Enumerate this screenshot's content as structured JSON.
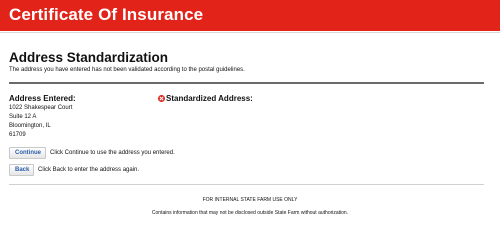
{
  "header": {
    "title": "Certificate Of Insurance",
    "background_color": "#e2231a"
  },
  "main": {
    "title": "Address Standardization",
    "subtitle": "The address you have entered has not been validated according to the postal guidelines.",
    "entered_address": {
      "heading": "Address Entered:",
      "lines": [
        "1022 Shakespear Court",
        "Suite 12 A",
        "Bloomington, IL",
        "61709"
      ]
    },
    "standardized_address": {
      "icon": "error-icon",
      "icon_color": "#d9231a",
      "heading": "Standardized Address:"
    },
    "actions": {
      "continue_label": "Continue",
      "continue_hint": "Click Continue to use the address you entered.",
      "back_label": "Back",
      "back_hint": "Click Back to enter the address again."
    }
  },
  "footer": {
    "line1": "FOR INTERNAL STATE FARM USE ONLY",
    "line2": "Contains information that may not be disclosed outside State Farm without authorization."
  }
}
